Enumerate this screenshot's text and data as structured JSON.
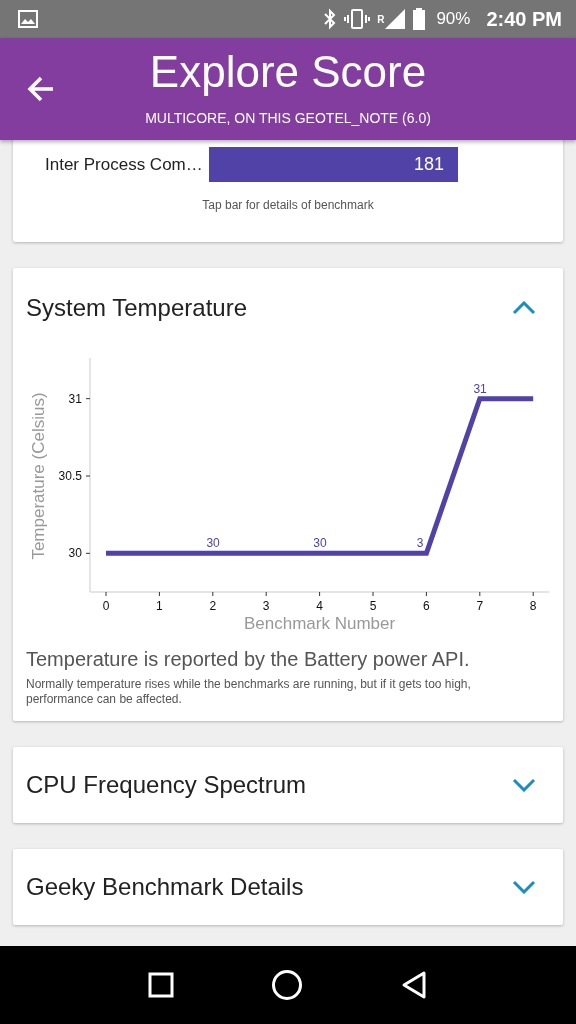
{
  "status_bar": {
    "signal_letter": "R",
    "battery": "90%",
    "time": "2:40 PM"
  },
  "app_bar": {
    "title": "Explore Score",
    "subtitle": "MULTICORE, ON THIS GEOTEL_NOTE (6.0)"
  },
  "score_card": {
    "bars": [
      {
        "label": "Inter Process Com…",
        "value": "181"
      }
    ],
    "hint": "Tap bar for details of benchmark"
  },
  "temperature_card": {
    "title": "System Temperature",
    "expanded": true,
    "chart_data": {
      "type": "line",
      "xlabel": "Benchmark Number",
      "ylabel": "Temperature (Celsius)",
      "x": [
        0,
        1,
        2,
        3,
        4,
        5,
        6,
        7,
        8
      ],
      "series": [
        {
          "color": "#5142a8",
          "values": [
            30,
            30,
            30,
            30,
            30,
            30,
            30,
            31,
            31
          ]
        }
      ],
      "xlim": [
        -0.3,
        8.3
      ],
      "ylim": [
        29.75,
        31.25
      ],
      "xticks": [
        0,
        1,
        2,
        3,
        4,
        5,
        6,
        7,
        8
      ],
      "yticks": [
        30,
        30.5,
        31
      ],
      "annotations": [
        {
          "x": 2,
          "y": 30,
          "text": "30"
        },
        {
          "x": 4,
          "y": 30,
          "text": "30"
        },
        {
          "x": 6,
          "y": 30,
          "text": "3"
        },
        {
          "x": 7,
          "y": 31,
          "text": "31"
        }
      ]
    },
    "note": "Temperature is reported by the Battery power API.",
    "detail": "Normally temperature rises while the benchmarks are running, but if it gets too high, performance can be affected."
  },
  "sections": [
    {
      "title": "CPU Frequency Spectrum",
      "expanded": false
    },
    {
      "title": "Geeky Benchmark Details",
      "expanded": false
    }
  ]
}
